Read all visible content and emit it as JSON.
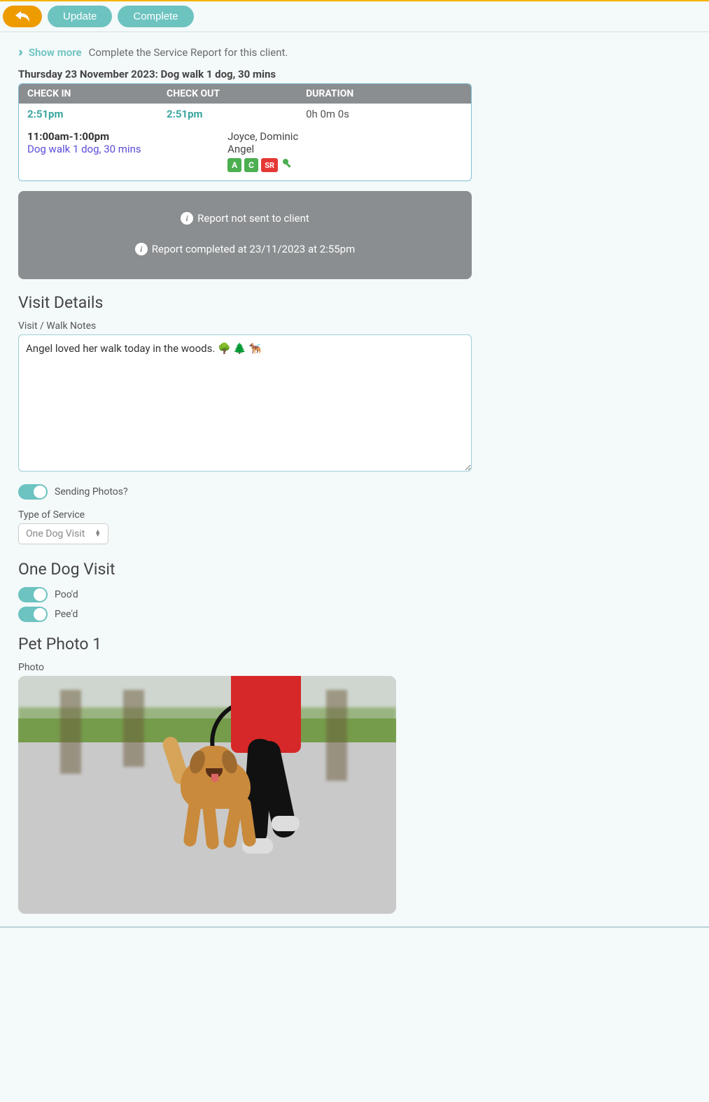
{
  "toolbar": {
    "update_label": "Update",
    "complete_label": "Complete"
  },
  "show_more": {
    "link": "Show more",
    "desc": "Complete the Service Report for this client."
  },
  "date_title": "Thursday 23 November 2023: Dog walk 1 dog, 30 mins",
  "check": {
    "h_in": "CHECK IN",
    "h_out": "CHECK OUT",
    "h_dur": "DURATION",
    "in_time": "2:51pm",
    "out_time": "2:51pm",
    "duration": "0h 0m 0s"
  },
  "visit": {
    "time_range": "11:00am-1:00pm",
    "service": "Dog walk 1 dog, 30 mins",
    "client": "Joyce, Dominic",
    "pet": "Angel",
    "badge_a": "A",
    "badge_c": "C",
    "badge_sr": "SR"
  },
  "status": {
    "line1": "Report not sent to client",
    "line2": "Report completed at 23/11/2023 at 2:55pm"
  },
  "sections": {
    "visit_details": "Visit Details",
    "one_dog": "One Dog Visit",
    "pet_photo": "Pet Photo 1"
  },
  "labels": {
    "notes": "Visit / Walk Notes",
    "sending_photos": "Sending Photos?",
    "type_of_service": "Type of Service",
    "pood": "Poo'd",
    "peed": "Pee'd",
    "photo": "Photo"
  },
  "form": {
    "notes": "Angel loved her walk today in the woods. 🌳 🌲 🐕‍🦺",
    "sending_photos": true,
    "type_of_service": "One Dog Visit",
    "pood": true,
    "peed": true
  }
}
